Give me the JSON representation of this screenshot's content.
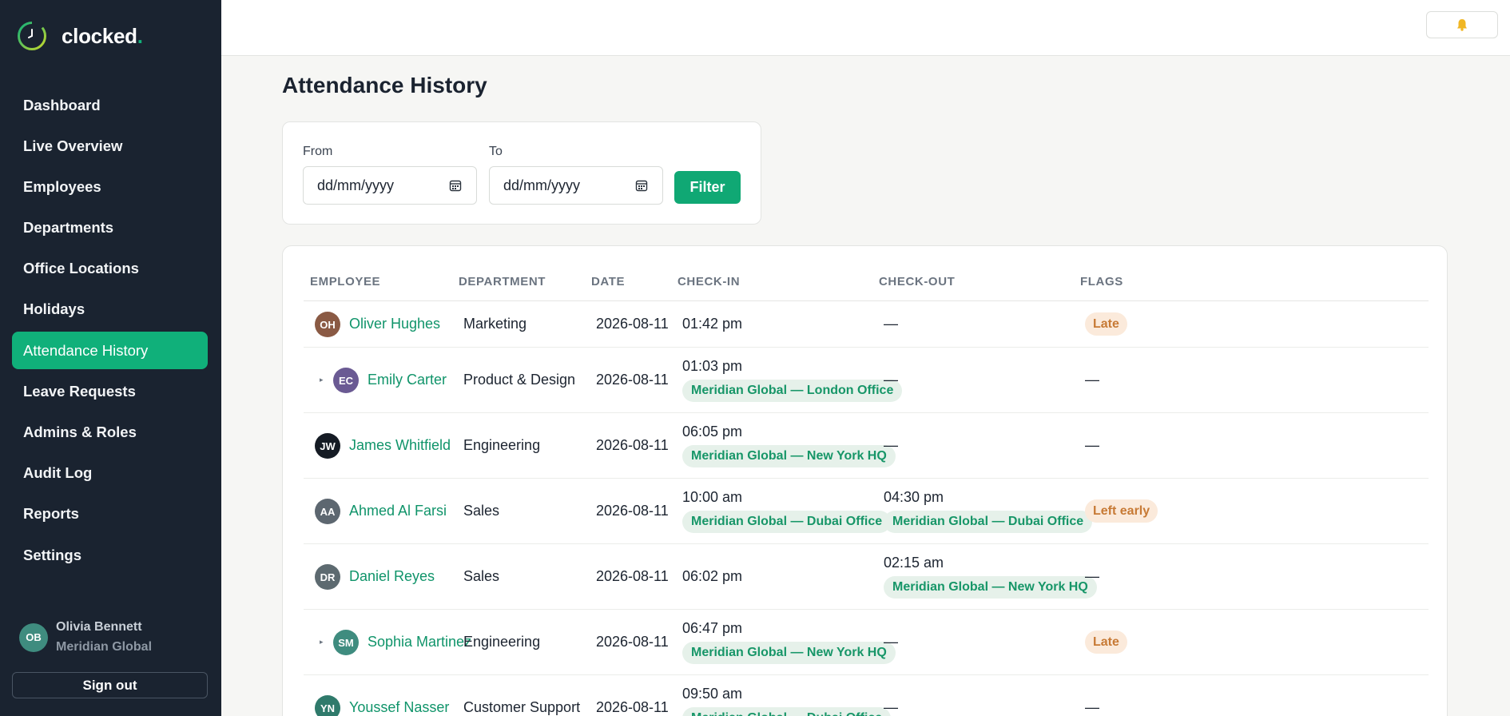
{
  "app": {
    "name": "clocked",
    "name_dot": ".",
    "brand_color": "#10b07a"
  },
  "sidebar": {
    "items": [
      {
        "label": "Dashboard",
        "active": false
      },
      {
        "label": "Live Overview",
        "active": false
      },
      {
        "label": "Employees",
        "active": false
      },
      {
        "label": "Departments",
        "active": false
      },
      {
        "label": "Office Locations",
        "active": false
      },
      {
        "label": "Holidays",
        "active": false
      },
      {
        "label": "Attendance History",
        "active": true
      },
      {
        "label": "Leave Requests",
        "active": false
      },
      {
        "label": "Admins & Roles",
        "active": false
      },
      {
        "label": "Audit Log",
        "active": false
      },
      {
        "label": "Reports",
        "active": false
      },
      {
        "label": "Settings",
        "active": false
      }
    ],
    "user": {
      "initials": "OB",
      "name": "Olivia Bennett",
      "org": "Meridian Global"
    },
    "signout_label": "Sign out"
  },
  "topbar": {
    "bell_icon": "bell-icon"
  },
  "page": {
    "title": "Attendance History"
  },
  "filter": {
    "from_label": "From",
    "to_label": "To",
    "from_value": "dd/mm/yyyy",
    "to_value": "dd/mm/yyyy",
    "button_label": "Filter"
  },
  "table": {
    "columns": [
      "EMPLOYEE",
      "DEPARTMENT",
      "DATE",
      "CHECK-IN",
      "CHECK-OUT",
      "FLAGS"
    ],
    "rows": [
      {
        "initials": "OH",
        "avatar_color": "#8a5a44",
        "name": "Oliver Hughes",
        "expandable": false,
        "department": "Marketing",
        "date": "2026-08-11",
        "check_in": "01:42 pm",
        "check_in_loc": "",
        "check_out": "—",
        "check_out_loc": "",
        "flag": "Late"
      },
      {
        "initials": "EC",
        "avatar_color": "#6a5a93",
        "name": "Emily Carter",
        "expandable": true,
        "department": "Product & Design",
        "date": "2026-08-11",
        "check_in": "01:03 pm",
        "check_in_loc": "Meridian Global — London Office",
        "check_out": "—",
        "check_out_loc": "",
        "flag": "—"
      },
      {
        "initials": "JW",
        "avatar_color": "#151b24",
        "name": "James Whitfield",
        "expandable": false,
        "department": "Engineering",
        "date": "2026-08-11",
        "check_in": "06:05 pm",
        "check_in_loc": "Meridian Global — New York HQ",
        "check_out": "—",
        "check_out_loc": "",
        "flag": "—"
      },
      {
        "initials": "AA",
        "avatar_color": "#5d6770",
        "name": "Ahmed Al Farsi",
        "expandable": false,
        "department": "Sales",
        "date": "2026-08-11",
        "check_in": "10:00 am",
        "check_in_loc": "Meridian Global — Dubai Office",
        "check_out": "04:30 pm",
        "check_out_loc": "Meridian Global — Dubai Office",
        "flag": "Left early"
      },
      {
        "initials": "DR",
        "avatar_color": "#5d6a70",
        "name": "Daniel Reyes",
        "expandable": false,
        "department": "Sales",
        "date": "2026-08-11",
        "check_in": "06:02 pm",
        "check_in_loc": "",
        "check_out": "02:15 am",
        "check_out_loc": "Meridian Global — New York HQ",
        "flag": "—"
      },
      {
        "initials": "SM",
        "avatar_color": "#3f8c7f",
        "name": "Sophia Martinez",
        "expandable": true,
        "department": "Engineering",
        "date": "2026-08-11",
        "check_in": "06:47 pm",
        "check_in_loc": "Meridian Global — New York HQ",
        "check_out": "—",
        "check_out_loc": "",
        "flag": "Late"
      },
      {
        "initials": "YN",
        "avatar_color": "#2f7a6b",
        "name": "Youssef Nasser",
        "expandable": false,
        "department": "Customer Support",
        "date": "2026-08-11",
        "check_in": "09:50 am",
        "check_in_loc": "Meridian Global — Dubai Office",
        "check_out": "—",
        "check_out_loc": "",
        "flag": "—"
      }
    ]
  }
}
